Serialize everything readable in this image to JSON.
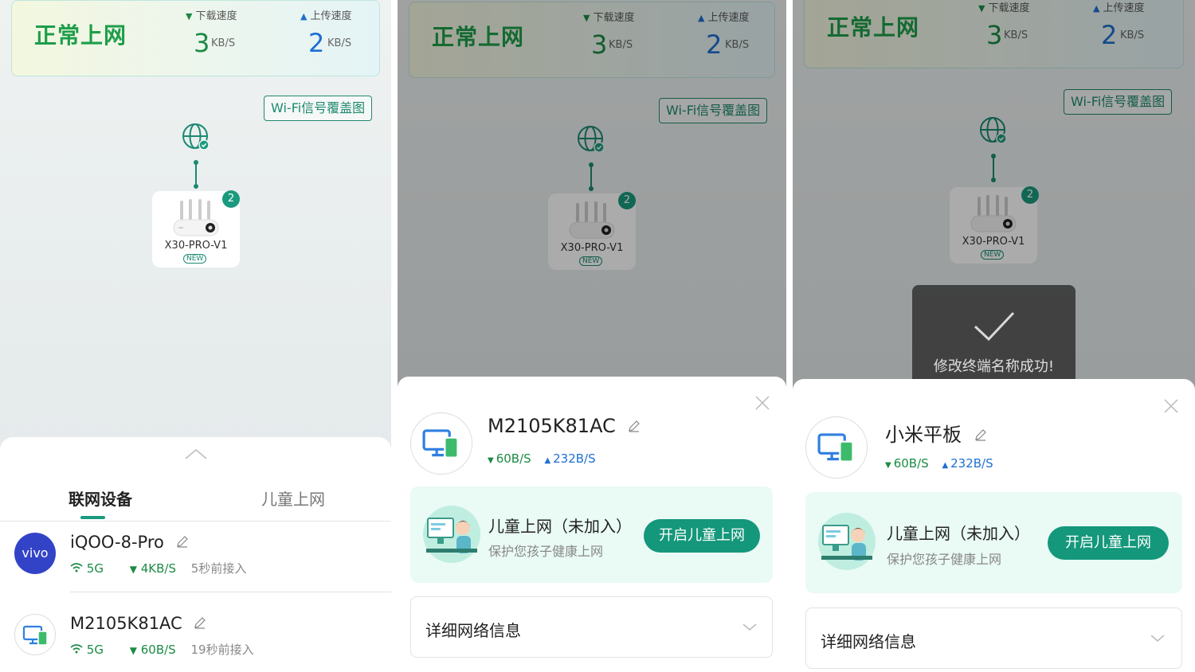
{
  "status": {
    "net_status": "正常上网",
    "download_label": "下载速度",
    "upload_label": "上传速度",
    "download_value": "3",
    "upload_value": "2",
    "unit": "KB/S",
    "download_tri": "▼",
    "upload_tri": "▲"
  },
  "wifi_coverage_button": "Wi-Fi信号覆盖图",
  "router": {
    "name": "X30-PRO-V1",
    "new_tag": "NEW",
    "badge_count": "2"
  },
  "device_list": {
    "tabs": [
      "联网设备",
      "儿童上网"
    ],
    "devices": [
      {
        "name": "iQOO-8-Pro",
        "avatar": "vivo",
        "band": "5G",
        "speed": "4KB/S",
        "ago": "5秒前接入"
      },
      {
        "name": "M2105K81AC",
        "avatar": "computer-phone-icon",
        "band": "5G",
        "speed": "60B/S",
        "ago": "19秒前接入"
      }
    ]
  },
  "detail_before": {
    "name": "M2105K81AC",
    "down_speed": "60B/S",
    "up_speed": "232B/S"
  },
  "detail_after": {
    "name": "小米平板",
    "down_speed": "60B/S",
    "up_speed": "232B/S"
  },
  "kids": {
    "title": "儿童上网（未加入）",
    "subtitle": "保护您孩子健康上网",
    "button": "开启儿童上网"
  },
  "network_info_label": "详细网络信息",
  "toast": {
    "message": "修改终端名称成功!"
  },
  "colors": {
    "brand_green": "#14977a",
    "download_green": "#1b8a45",
    "upload_blue": "#1e6fd0",
    "vivo_blue": "#3343c8"
  }
}
